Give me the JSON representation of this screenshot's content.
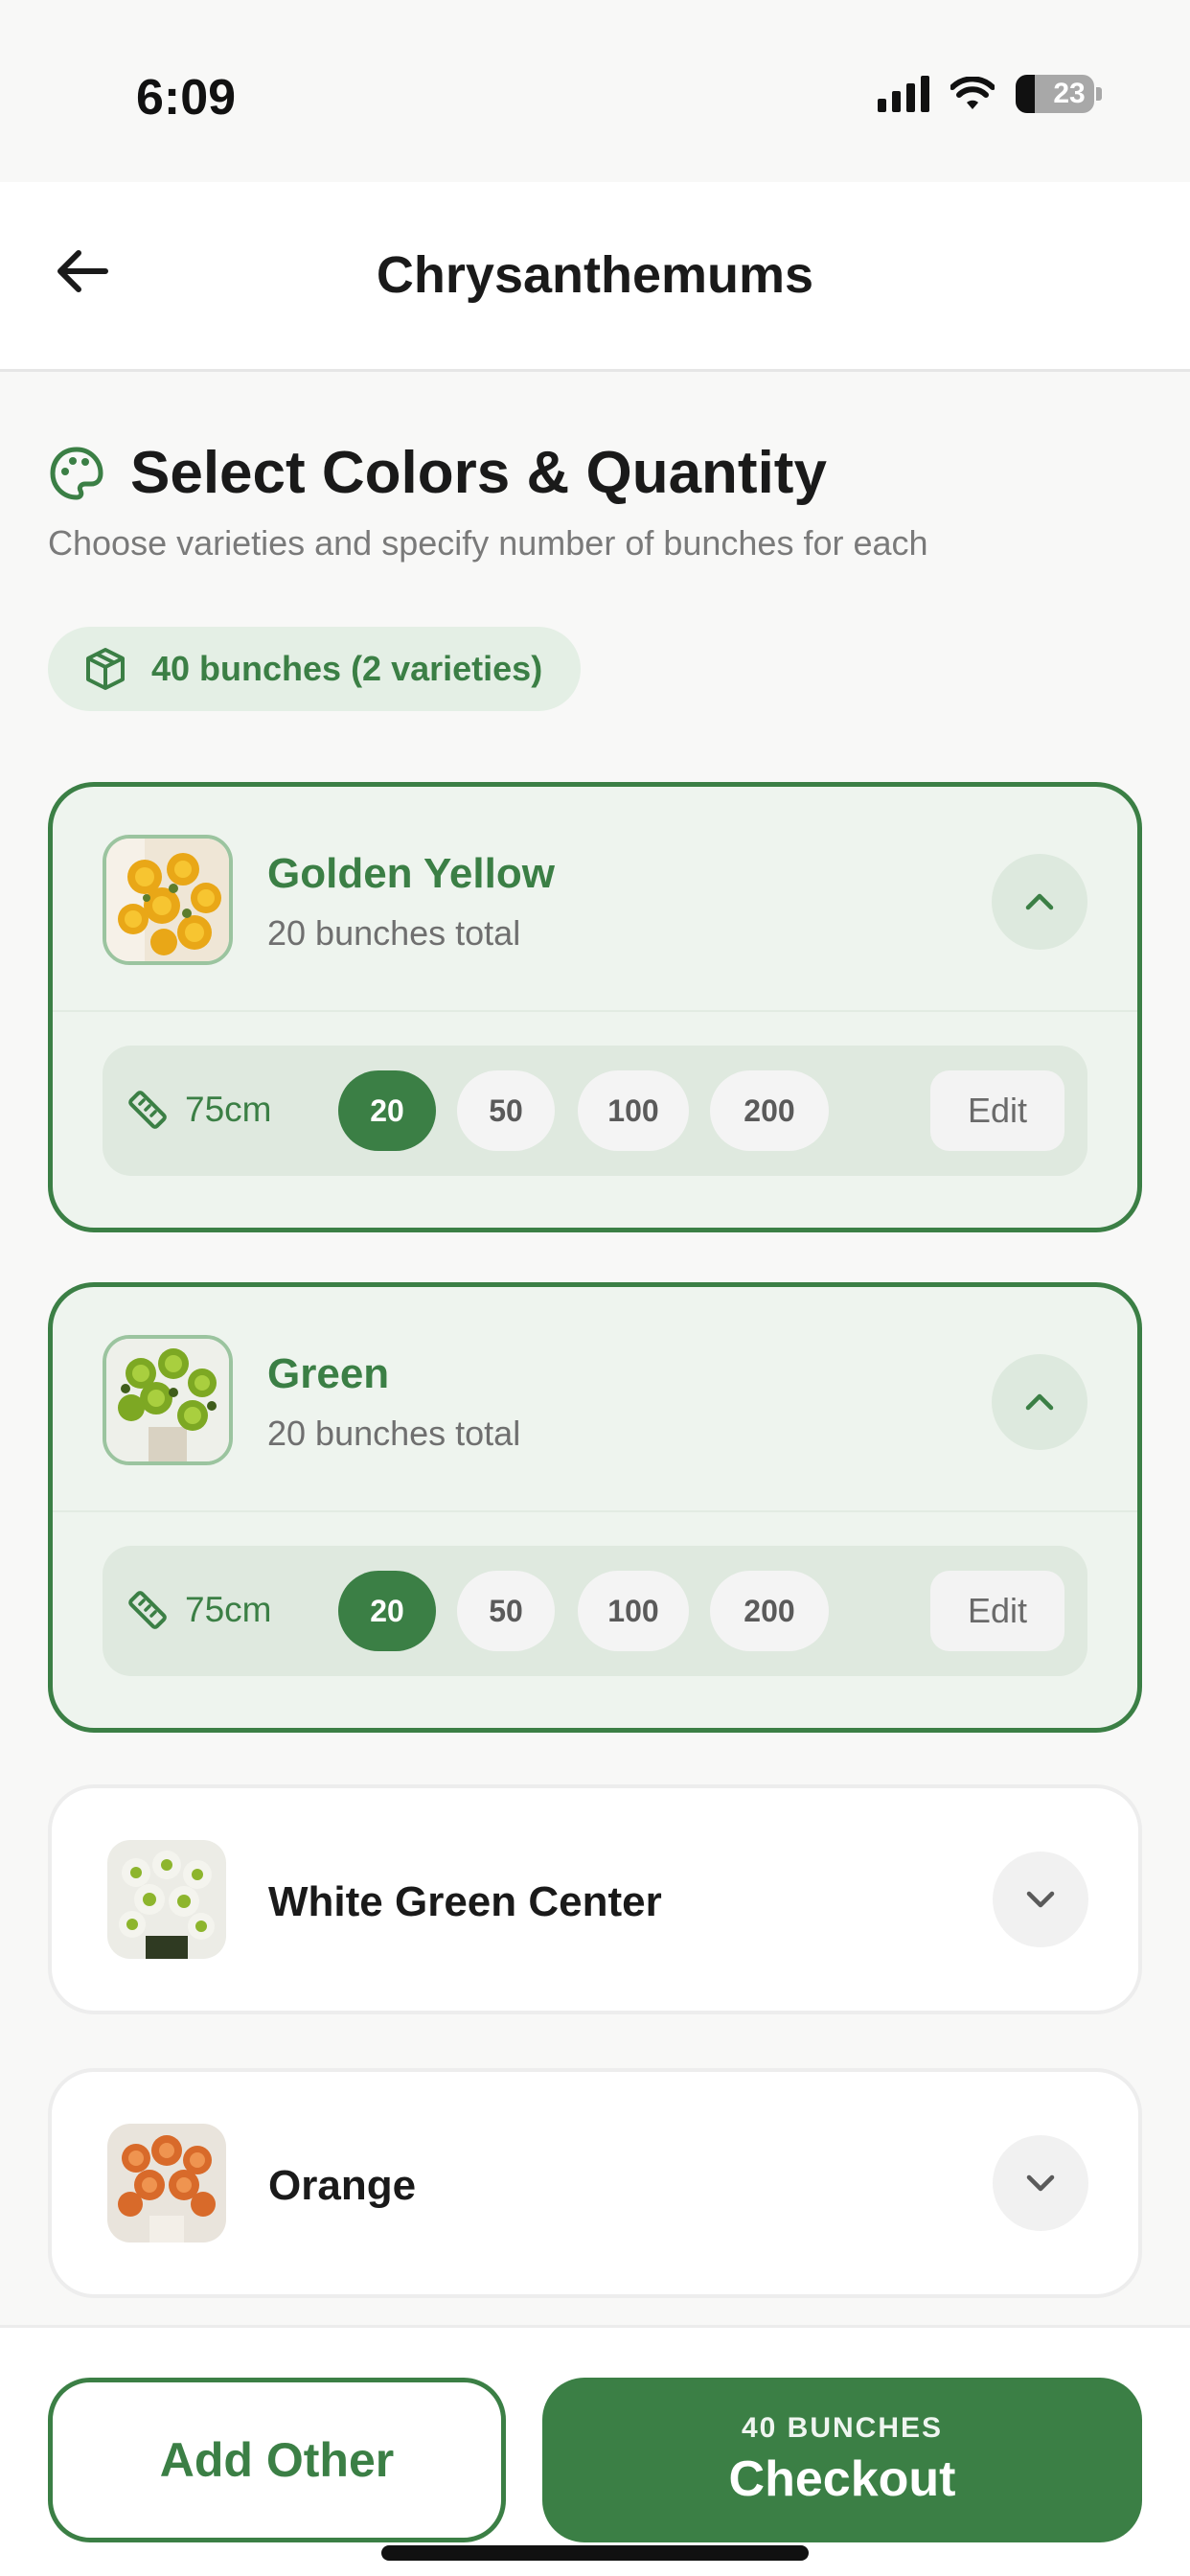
{
  "status_bar": {
    "time": "6:09",
    "battery_level": "23"
  },
  "nav": {
    "title": "Chrysanthemums"
  },
  "section": {
    "title": "Select Colors & Quantity",
    "subtitle": "Choose varieties and specify number of bunches for each"
  },
  "summary": {
    "text": "40 bunches (2 varieties)"
  },
  "varieties": [
    {
      "name": "Golden Yellow",
      "total": "20 bunches total",
      "length": "75cm",
      "options": [
        "20",
        "50",
        "100",
        "200"
      ],
      "selected": "20",
      "edit_label": "Edit"
    },
    {
      "name": "Green",
      "total": "20 bunches total",
      "length": "75cm",
      "options": [
        "20",
        "50",
        "100",
        "200"
      ],
      "selected": "20",
      "edit_label": "Edit"
    },
    {
      "name": "White Green Center"
    },
    {
      "name": "Orange"
    }
  ],
  "footer": {
    "add_other_label": "Add Other",
    "checkout_sub": "40 BUNCHES",
    "checkout_label": "Checkout"
  },
  "colors": {
    "accent": "#3b7f45",
    "accent_light": "#eef4ee"
  }
}
